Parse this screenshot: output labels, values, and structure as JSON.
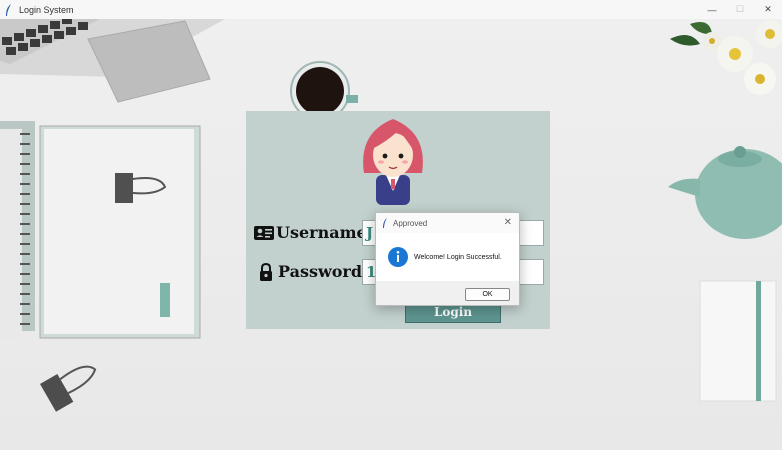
{
  "window": {
    "title": "Login System",
    "minimize": "—",
    "maximize": "☐",
    "close": "✕"
  },
  "form": {
    "username_label": "Username",
    "password_label": "Password",
    "username_value": "J",
    "password_value": "1",
    "login_label": "Login"
  },
  "dialog": {
    "title": "Approved",
    "message": "Welcome! Login Successful.",
    "ok_label": "OK",
    "close": "✕",
    "icon": "info-icon"
  },
  "colors": {
    "panel": "#c2d1ce",
    "accent": "#5e9590",
    "info": "#1a78d4"
  }
}
